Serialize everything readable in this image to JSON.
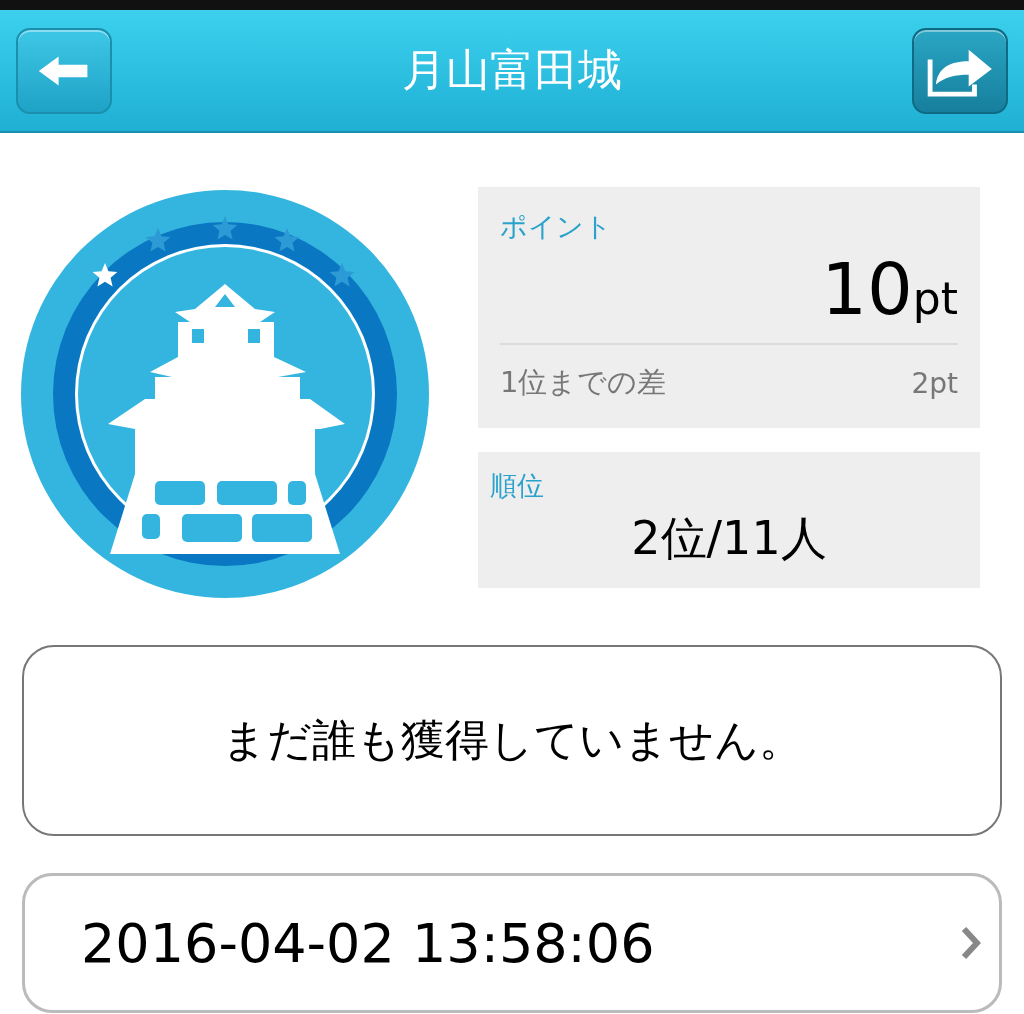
{
  "header": {
    "title": "月山富田城"
  },
  "badge": {
    "stars": 1
  },
  "points": {
    "label": "ポイント",
    "value": "10",
    "unit": "pt",
    "gap_label": "1位までの差",
    "gap_value": "2pt"
  },
  "rank": {
    "label": "順位",
    "value": "2位/11人"
  },
  "message": "まだ誰も獲得していません。",
  "date_row": {
    "text": "2016-04-02 13:58:06"
  }
}
